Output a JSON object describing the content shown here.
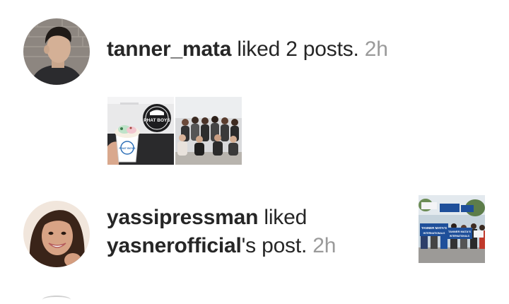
{
  "activity": [
    {
      "username": "tanner_mata",
      "action": " liked 2 posts. ",
      "time": "2h",
      "avatar": "profile-photo-man-dark-hair",
      "thumbnails": [
        {
          "icon": "ice-cream-cup-photo",
          "logo_line1": "PHAT BOYS",
          "cup_text": "PHAT BOYS"
        },
        {
          "icon": "group-photo"
        }
      ]
    },
    {
      "username": "yassipressman",
      "action": " liked",
      "post_owner": "yasnerofficial",
      "post_suffix": "'s post. ",
      "time": "2h",
      "avatar": "profile-photo-woman-smiling",
      "thumbnail": {
        "icon": "crowd-with-banners-photo",
        "banner1": "TANNER MATA'S",
        "banner1_sub": "INTERNATIONALS",
        "banner2": "TANNER MATA'S",
        "banner2_sub": "INTERNATIONALS"
      }
    }
  ],
  "colors": {
    "text": "#262626",
    "timestamp": "#9a9a9a",
    "background": "#ffffff"
  }
}
